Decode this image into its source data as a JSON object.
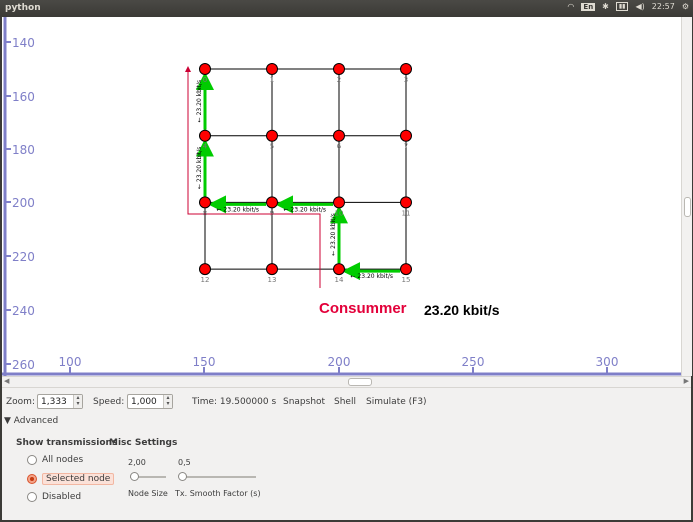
{
  "topbar": {
    "title": "python",
    "keyboard": "En",
    "time": "22:57"
  },
  "canvas": {
    "y_ticks": [
      "140",
      "160",
      "180",
      "200",
      "220",
      "240",
      "260"
    ],
    "x_ticks": [
      "100",
      "150",
      "200",
      "250",
      "300"
    ],
    "nodes": [
      {
        "id": "0",
        "col": 0,
        "row": 0
      },
      {
        "id": "1",
        "col": 1,
        "row": 0
      },
      {
        "id": "2",
        "col": 2,
        "row": 0
      },
      {
        "id": "3",
        "col": 3,
        "row": 0
      },
      {
        "id": "4",
        "col": 0,
        "row": 1
      },
      {
        "id": "5",
        "col": 1,
        "row": 1
      },
      {
        "id": "6",
        "col": 2,
        "row": 1
      },
      {
        "id": "7",
        "col": 3,
        "row": 1
      },
      {
        "id": "8",
        "col": 0,
        "row": 2
      },
      {
        "id": "9",
        "col": 1,
        "row": 2
      },
      {
        "id": "10",
        "col": 2,
        "row": 2
      },
      {
        "id": "11",
        "col": 3,
        "row": 2
      },
      {
        "id": "12",
        "col": 0,
        "row": 3
      },
      {
        "id": "13",
        "col": 1,
        "row": 3
      },
      {
        "id": "14",
        "col": 2,
        "row": 3
      },
      {
        "id": "15",
        "col": 3,
        "row": 3
      }
    ],
    "flows": [
      {
        "from": "15",
        "to": "14",
        "label": "23.20 kbit/s"
      },
      {
        "from": "14",
        "to": "10",
        "label": "23.20 kbit/s"
      },
      {
        "from": "10",
        "to": "9",
        "label": "23.20 kbit/s"
      },
      {
        "from": "9",
        "to": "8",
        "label": "23.20 kbit/s"
      },
      {
        "from": "8",
        "to": "4",
        "label": "23.20 kbit/s"
      },
      {
        "from": "4",
        "to": "0",
        "label": "23.20 kbit/s"
      }
    ],
    "consumer_label": "Consummer",
    "consumer_rate": "23.20 kbit/s",
    "colors": {
      "node_fill": "#ff0000",
      "flow": "#00cc00",
      "consumer_line": "#cc0033",
      "axis": "#7f7fc8"
    }
  },
  "controls": {
    "zoom_label": "Zoom:",
    "zoom_value": "1,333",
    "speed_label": "Speed:",
    "speed_value": "1,000",
    "time_text": "Time: 19.500000 s",
    "snapshot": "Snapshot",
    "shell": "Shell",
    "simulate": "Simulate (F3)",
    "advanced": "Advanced"
  },
  "advanced": {
    "show_transmissions_title": "Show transmissions",
    "options": [
      "All nodes",
      "Selected node",
      "Disabled"
    ],
    "selected_option": "Selected node",
    "misc_title": "Misc Settings",
    "node_size_value": "2,00",
    "node_size_label": "Node Size",
    "smooth_value": "0,5",
    "smooth_label": "Tx. Smooth Factor (s)"
  }
}
